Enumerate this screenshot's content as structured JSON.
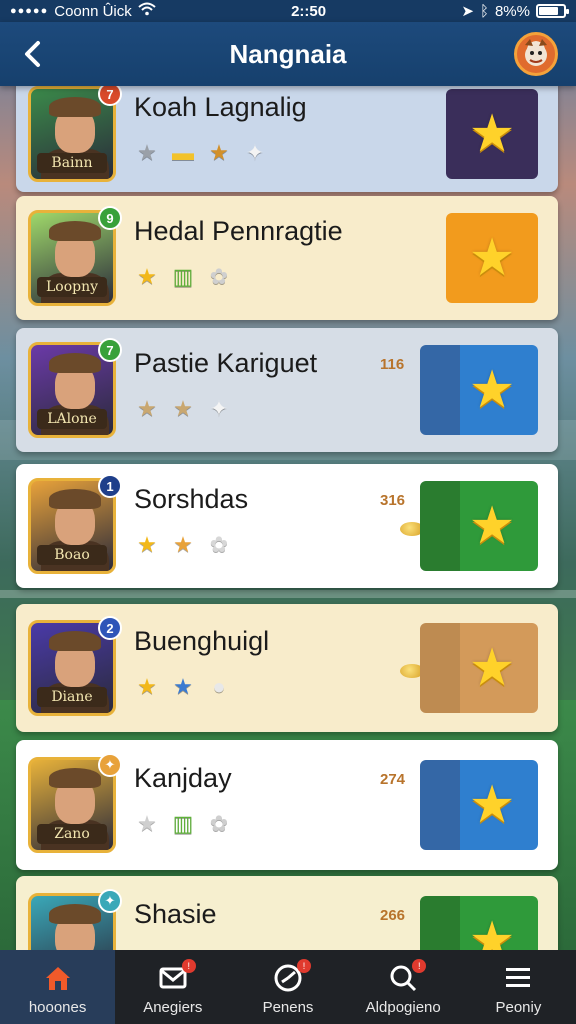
{
  "status_bar": {
    "carrier": "Coonn Ûick",
    "time": "2::50",
    "battery_text": "8%%",
    "battery_level": 0.8
  },
  "header": {
    "title": "Nangnaia"
  },
  "rows": [
    {
      "name": "Koah Lagnalig",
      "badge": "7",
      "badge_color": "#d94a2a",
      "plate": "Bainn",
      "score": "",
      "bg": "#c9d7ea",
      "btn_color": "#3a2e5a",
      "side_color": "",
      "portrait_bg": "#3b8a4a",
      "icons": [
        "★",
        "▬",
        "★",
        "✦"
      ],
      "icon_colors": [
        "#9aa0a8",
        "#f2c22b",
        "#d2902a",
        "#f3f3f3"
      ]
    },
    {
      "name": "Hedal Pennragtie",
      "badge": "9",
      "badge_color": "#38a13a",
      "plate": "Loopny",
      "score": "",
      "bg": "#f8eccb",
      "btn_color": "#f29b1d",
      "side_color": "",
      "portrait_bg": "#9fd86a",
      "icons": [
        "★",
        "▥",
        "✿"
      ],
      "icon_colors": [
        "#f2b81a",
        "#5fb13a",
        "#cfcfcf"
      ]
    },
    {
      "name": "Pastie Kariguet",
      "badge": "7",
      "badge_color": "#38a13a",
      "plate": "LAlone",
      "score": "116",
      "bg": "#d6dde6",
      "btn_color": "#2f7fcf",
      "side_color": "#3a72b8",
      "portrait_bg": "#6b3aa8",
      "icons": [
        "★",
        "★",
        "✦"
      ],
      "icon_colors": [
        "#c9a770",
        "#c9a770",
        "#f4f4f4"
      ]
    },
    {
      "name": "Sorshdas",
      "badge": "1",
      "badge_color": "#1f3f8a",
      "plate": "Boao",
      "score": "316",
      "bg": "#ffffff",
      "btn_color": "#2f9a3a",
      "side_color": "#2f8a34",
      "portrait_bg": "#e8a23a",
      "icons": [
        "★",
        "★",
        "✿"
      ],
      "icon_colors": [
        "#f2b81a",
        "#e8a23a",
        "#d7d7d7"
      ]
    },
    {
      "name": "Buenghuigl",
      "badge": "2",
      "badge_color": "#2f55b8",
      "plate": "Diane",
      "score": "",
      "bg": "#f8eccb",
      "btn_color": "#d39a5a",
      "side_color": "#d39a5a",
      "portrait_bg": "#4a3aa8",
      "icons": [
        "★",
        "★",
        "●"
      ],
      "icon_colors": [
        "#f2b81a",
        "#3a7ad0",
        "#e8e8e8"
      ]
    },
    {
      "name": "Kanjday",
      "badge": "✦",
      "badge_color": "#e8a23a",
      "plate": "Zano",
      "score": "274",
      "bg": "#ffffff",
      "btn_color": "#2f7fcf",
      "side_color": "#3a72b8",
      "portrait_bg": "#e8b23a",
      "icons": [
        "★",
        "▥",
        "✿"
      ],
      "icon_colors": [
        "#cfcfcf",
        "#5fb13a",
        "#cfcfcf"
      ]
    },
    {
      "name": "Shasie",
      "badge": "✦",
      "badge_color": "#3aa8b8",
      "plate": "",
      "score": "266",
      "bg": "#f6efcf",
      "btn_color": "#2f9a3a",
      "side_color": "#2f8a34",
      "portrait_bg": "#3aa8b8",
      "icons": [
        "★",
        "★",
        "✿"
      ],
      "icon_colors": [
        "#f2b81a",
        "#f2b81a",
        "#d7d7d7"
      ]
    }
  ],
  "bottom_nav": [
    {
      "label": "hooones",
      "icon": "home-icon",
      "active": true,
      "badge": ""
    },
    {
      "label": "Anegiers",
      "icon": "mail-icon",
      "active": false,
      "badge": "!"
    },
    {
      "label": "Penens",
      "icon": "clock-icon",
      "active": false,
      "badge": "!"
    },
    {
      "label": "Aldpogieno",
      "icon": "search-icon",
      "active": false,
      "badge": "!"
    },
    {
      "label": "Peoniy",
      "icon": "menu-icon",
      "active": false,
      "badge": ""
    }
  ]
}
